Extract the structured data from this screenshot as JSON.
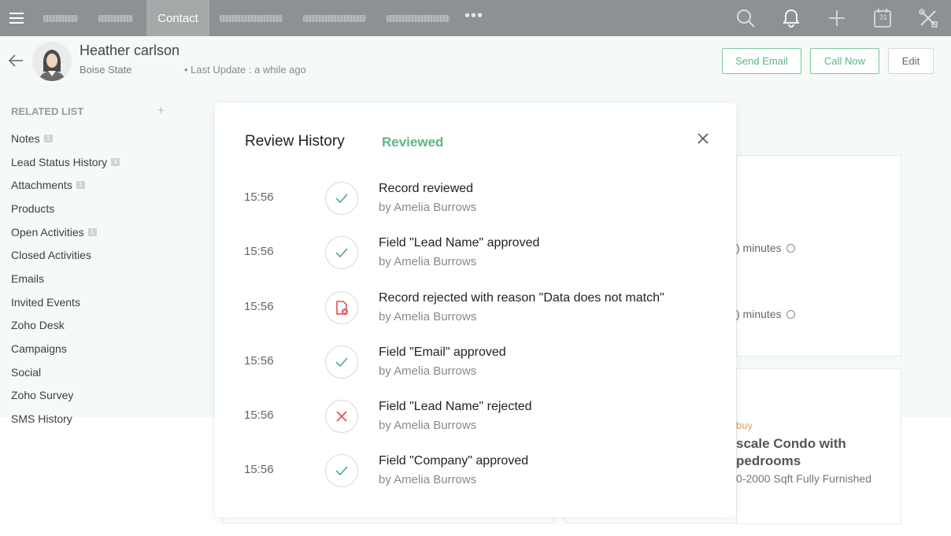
{
  "topnav": {
    "active_tab": "Contact",
    "more": "•••",
    "icons": [
      "search-icon",
      "bell-icon",
      "plus-icon",
      "calendar-icon",
      "tools-icon"
    ],
    "calendar_day": "31"
  },
  "header": {
    "name": "Heather carlson",
    "organization": "Boise State",
    "last_update": "• Last Update : a while ago",
    "buttons": {
      "send_email": "Send Email",
      "call_now": "Call Now",
      "edit": "Edit"
    }
  },
  "sidebar": {
    "title": "RELATED LIST",
    "add": "+",
    "items": [
      {
        "label": "Notes",
        "badge": "1"
      },
      {
        "label": "Lead Status History",
        "badge": "4"
      },
      {
        "label": "Attachments",
        "badge": "1"
      },
      {
        "label": "Products",
        "badge": ""
      },
      {
        "label": "Open Activities",
        "badge": "1"
      },
      {
        "label": "Closed Activities",
        "badge": ""
      },
      {
        "label": "Emails",
        "badge": ""
      },
      {
        "label": "Invited Events",
        "badge": ""
      },
      {
        "label": "Zoho Desk",
        "badge": ""
      },
      {
        "label": "Campaigns",
        "badge": ""
      },
      {
        "label": "Social",
        "badge": ""
      },
      {
        "label": "Zoho Survey",
        "badge": ""
      },
      {
        "label": "SMS History",
        "badge": ""
      }
    ]
  },
  "background": {
    "minutes_1": ") minutes",
    "minutes_2": ") minutes",
    "buy": "buy",
    "title_line1": "scale Condo with",
    "title_line2": "pedrooms",
    "subtitle": "0-2000 Sqft Fully Furnished"
  },
  "modal": {
    "title": "Review History",
    "status": "Reviewed",
    "entries": [
      {
        "time": "15:56",
        "icon": "check-icon",
        "title": "Record reviewed",
        "by": "by Amelia Burrows"
      },
      {
        "time": "15:56",
        "icon": "check-icon",
        "title": "Field \"Lead Name\" approved",
        "by": "by Amelia Burrows"
      },
      {
        "time": "15:56",
        "icon": "record-rejected-icon",
        "title": "Record rejected with reason \"Data does not match\"",
        "by": "by Amelia Burrows"
      },
      {
        "time": "15:56",
        "icon": "check-icon",
        "title": "Field \"Email\" approved",
        "by": "by Amelia Burrows"
      },
      {
        "time": "15:56",
        "icon": "cross-icon",
        "title": "Field \"Lead Name\" rejected",
        "by": "by Amelia Burrows"
      },
      {
        "time": "15:56",
        "icon": "check-icon",
        "title": "Field \"Company\" approved",
        "by": "by Amelia Burrows"
      }
    ]
  },
  "colors": {
    "accent_green": "#5cb682",
    "reject_red": "#e05252",
    "nav_bg": "#8c9193",
    "panel_bg": "#f5faf6"
  }
}
